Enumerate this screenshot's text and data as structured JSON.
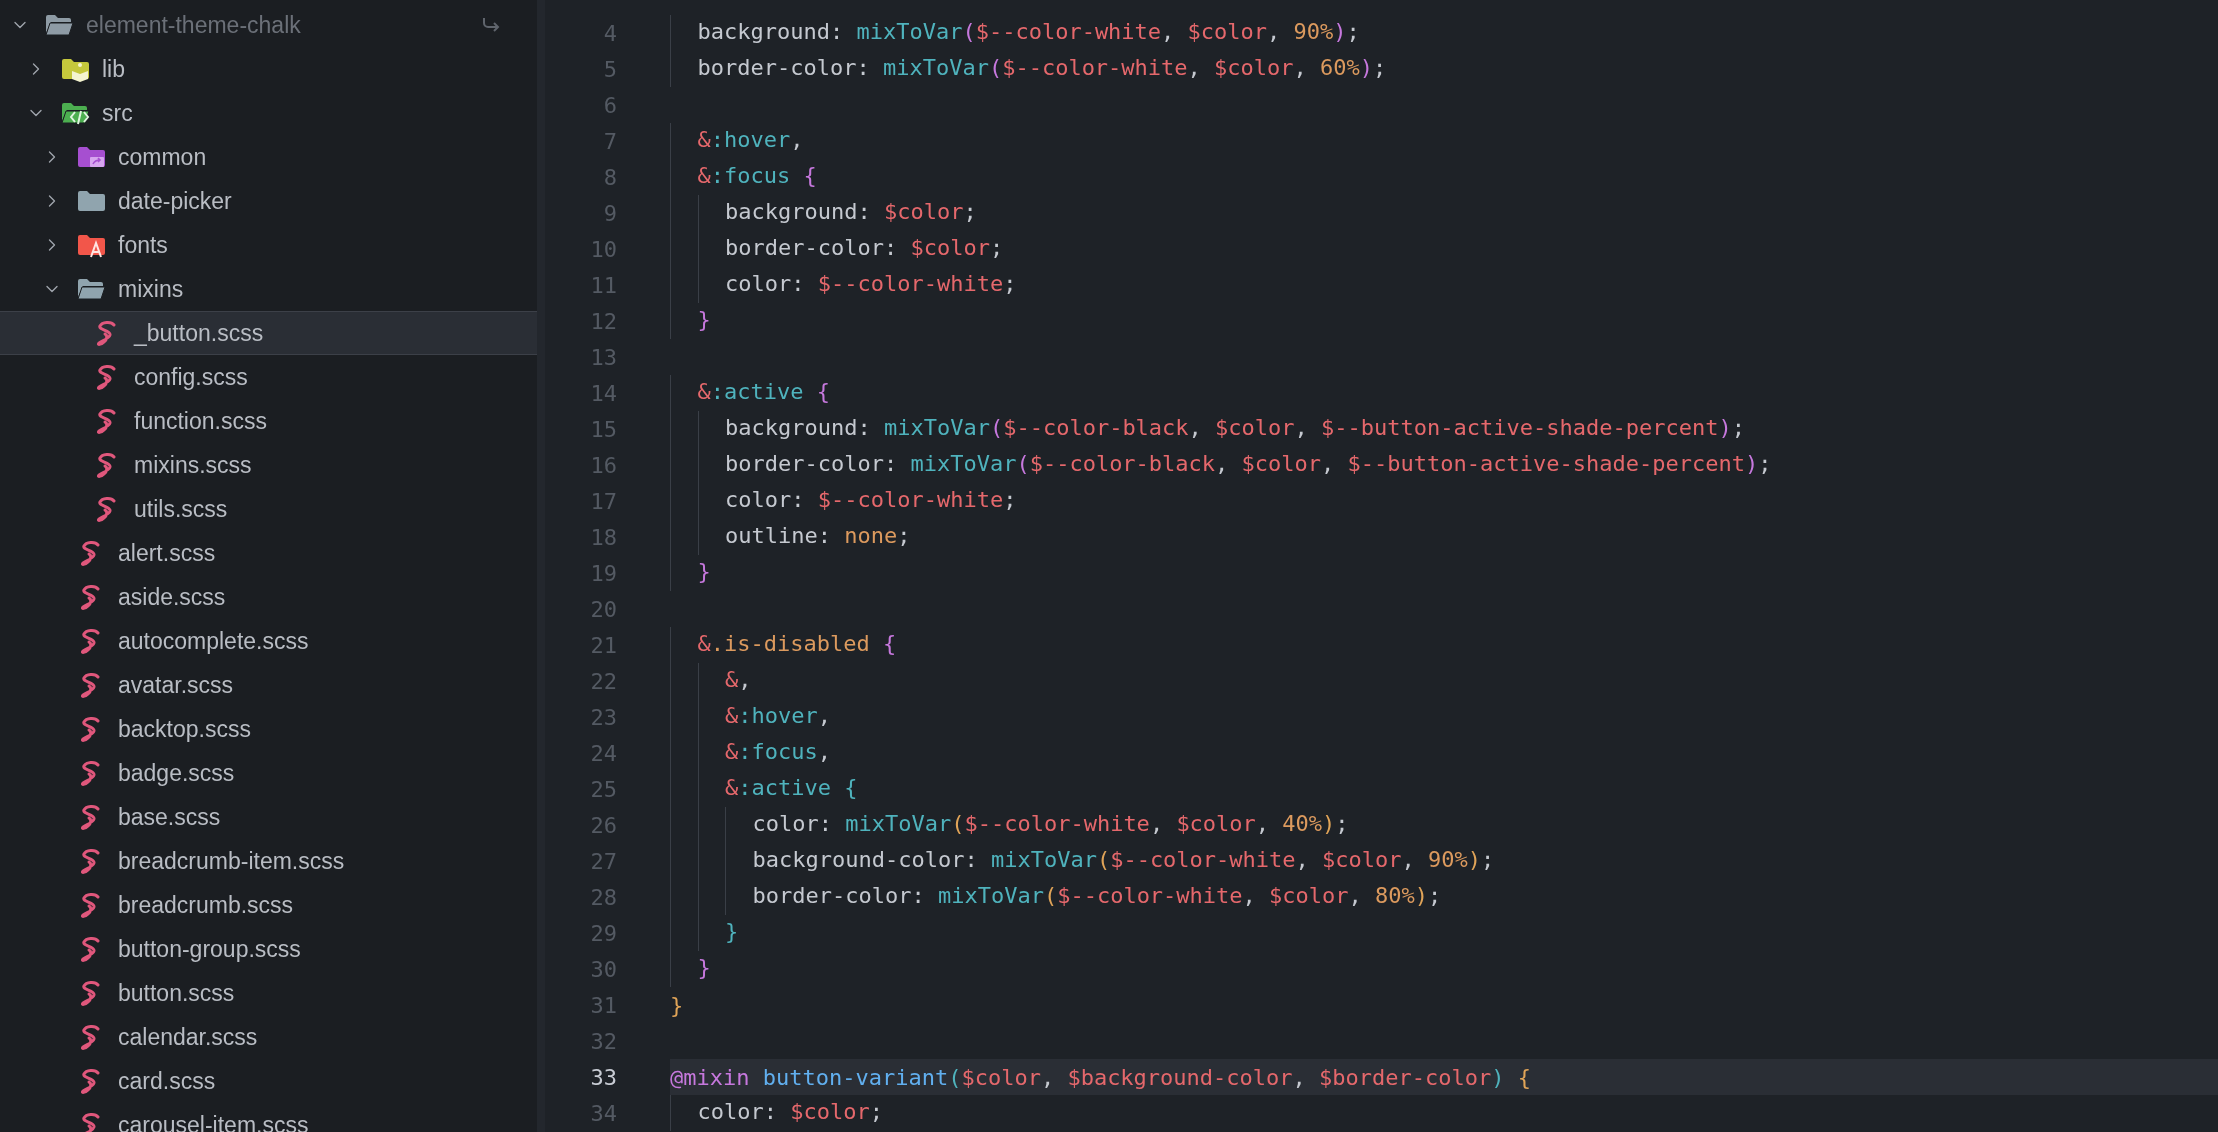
{
  "sidebar": {
    "tree": [
      {
        "label": "element-theme-chalk",
        "kind": "folder",
        "color": "#8e9ba5",
        "expanded": true,
        "selected": false,
        "children": [
          {
            "label": "lib",
            "kind": "library-folder",
            "color": "#c5c83c",
            "expanded": false,
            "selected": false
          },
          {
            "label": "src",
            "kind": "source-folder",
            "color": "#4caf50",
            "expanded": true,
            "selected": false,
            "children": [
              {
                "label": "common",
                "kind": "shared-folder",
                "color": "#a64fd0",
                "expanded": false,
                "selected": false
              },
              {
                "label": "date-picker",
                "kind": "folder",
                "color": "#90a4ae",
                "expanded": false,
                "selected": false
              },
              {
                "label": "fonts",
                "kind": "font-folder",
                "color": "#f2564a",
                "expanded": false,
                "selected": false
              },
              {
                "label": "mixins",
                "kind": "folder",
                "color": "#90a4ae",
                "expanded": true,
                "selected": false,
                "children": [
                  {
                    "label": "_button.scss",
                    "kind": "scss-file",
                    "selected": true
                  },
                  {
                    "label": "config.scss",
                    "kind": "scss-file",
                    "selected": false
                  },
                  {
                    "label": "function.scss",
                    "kind": "scss-file",
                    "selected": false
                  },
                  {
                    "label": "mixins.scss",
                    "kind": "scss-file",
                    "selected": false
                  },
                  {
                    "label": "utils.scss",
                    "kind": "scss-file",
                    "selected": false
                  }
                ]
              },
              {
                "label": "alert.scss",
                "kind": "scss-file",
                "selected": false
              },
              {
                "label": "aside.scss",
                "kind": "scss-file",
                "selected": false
              },
              {
                "label": "autocomplete.scss",
                "kind": "scss-file",
                "selected": false
              },
              {
                "label": "avatar.scss",
                "kind": "scss-file",
                "selected": false
              },
              {
                "label": "backtop.scss",
                "kind": "scss-file",
                "selected": false
              },
              {
                "label": "badge.scss",
                "kind": "scss-file",
                "selected": false
              },
              {
                "label": "base.scss",
                "kind": "scss-file",
                "selected": false
              },
              {
                "label": "breadcrumb-item.scss",
                "kind": "scss-file",
                "selected": false
              },
              {
                "label": "breadcrumb.scss",
                "kind": "scss-file",
                "selected": false
              },
              {
                "label": "button-group.scss",
                "kind": "scss-file",
                "selected": false
              },
              {
                "label": "button.scss",
                "kind": "scss-file",
                "selected": false
              },
              {
                "label": "calendar.scss",
                "kind": "scss-file",
                "selected": false
              },
              {
                "label": "card.scss",
                "kind": "scss-file",
                "selected": false
              },
              {
                "label": "carousel-item.scss",
                "kind": "scss-file",
                "selected": false
              }
            ]
          }
        ]
      }
    ]
  },
  "editor": {
    "lines": [
      {
        "number": "4",
        "current": false,
        "tokens": [
          {
            "text": "  background: ",
            "kind": "prop"
          },
          {
            "text": "mixToVar",
            "kind": "fn"
          },
          {
            "text": "(",
            "kind": "bracket1"
          },
          {
            "text": "$--color-white",
            "kind": "var"
          },
          {
            "text": ", ",
            "kind": "punc"
          },
          {
            "text": "$color",
            "kind": "var"
          },
          {
            "text": ", ",
            "kind": "punc"
          },
          {
            "text": "90%",
            "kind": "num"
          },
          {
            "text": ")",
            "kind": "bracket1"
          },
          {
            "text": ";",
            "kind": "punc"
          }
        ]
      },
      {
        "number": "5",
        "current": false,
        "tokens": [
          {
            "text": "  border-color: ",
            "kind": "prop"
          },
          {
            "text": "mixToVar",
            "kind": "fn"
          },
          {
            "text": "(",
            "kind": "bracket1"
          },
          {
            "text": "$--color-white",
            "kind": "var"
          },
          {
            "text": ", ",
            "kind": "punc"
          },
          {
            "text": "$color",
            "kind": "var"
          },
          {
            "text": ", ",
            "kind": "punc"
          },
          {
            "text": "60%",
            "kind": "num"
          },
          {
            "text": ")",
            "kind": "bracket1"
          },
          {
            "text": ";",
            "kind": "punc"
          }
        ]
      },
      {
        "number": "6",
        "current": false
      },
      {
        "number": "7",
        "current": false,
        "tokens": [
          {
            "text": "  &",
            "kind": "var"
          },
          {
            "text": ":hover",
            "kind": "fn"
          },
          {
            "text": ",",
            "kind": "punc"
          }
        ]
      },
      {
        "number": "8",
        "current": false,
        "tokens": [
          {
            "text": "  &",
            "kind": "var"
          },
          {
            "text": ":focus",
            "kind": "fn"
          },
          {
            "text": " {",
            "kind": "bracket1"
          }
        ]
      },
      {
        "number": "9",
        "current": false,
        "tokens": [
          {
            "text": "    background: ",
            "kind": "prop"
          },
          {
            "text": "$color",
            "kind": "var"
          },
          {
            "text": ";",
            "kind": "punc"
          }
        ]
      },
      {
        "number": "10",
        "current": false,
        "tokens": [
          {
            "text": "    border-color: ",
            "kind": "prop"
          },
          {
            "text": "$color",
            "kind": "var"
          },
          {
            "text": ";",
            "kind": "punc"
          }
        ]
      },
      {
        "number": "11",
        "current": false,
        "tokens": [
          {
            "text": "    color: ",
            "kind": "prop"
          },
          {
            "text": "$--color-white",
            "kind": "var"
          },
          {
            "text": ";",
            "kind": "punc"
          }
        ]
      },
      {
        "number": "12",
        "current": false,
        "tokens": [
          {
            "text": "  }",
            "kind": "bracket1"
          }
        ]
      },
      {
        "number": "13",
        "current": false
      },
      {
        "number": "14",
        "current": false,
        "tokens": [
          {
            "text": "  &",
            "kind": "var"
          },
          {
            "text": ":active",
            "kind": "fn"
          },
          {
            "text": " {",
            "kind": "bracket1"
          }
        ]
      },
      {
        "number": "15",
        "current": false,
        "tokens": [
          {
            "text": "    background: ",
            "kind": "prop"
          },
          {
            "text": "mixToVar",
            "kind": "fn"
          },
          {
            "text": "(",
            "kind": "bracket1"
          },
          {
            "text": "$--color-black",
            "kind": "var"
          },
          {
            "text": ", ",
            "kind": "punc"
          },
          {
            "text": "$color",
            "kind": "var"
          },
          {
            "text": ", ",
            "kind": "punc"
          },
          {
            "text": "$--button-active-shade-percent",
            "kind": "var"
          },
          {
            "text": ")",
            "kind": "bracket1"
          },
          {
            "text": ";",
            "kind": "punc"
          }
        ]
      },
      {
        "number": "16",
        "current": false,
        "tokens": [
          {
            "text": "    border-color: ",
            "kind": "prop"
          },
          {
            "text": "mixToVar",
            "kind": "fn"
          },
          {
            "text": "(",
            "kind": "bracket1"
          },
          {
            "text": "$--color-black",
            "kind": "var"
          },
          {
            "text": ", ",
            "kind": "punc"
          },
          {
            "text": "$color",
            "kind": "var"
          },
          {
            "text": ", ",
            "kind": "punc"
          },
          {
            "text": "$--button-active-shade-percent",
            "kind": "var"
          },
          {
            "text": ")",
            "kind": "bracket1"
          },
          {
            "text": ";",
            "kind": "punc"
          }
        ]
      },
      {
        "number": "17",
        "current": false,
        "tokens": [
          {
            "text": "    color: ",
            "kind": "prop"
          },
          {
            "text": "$--color-white",
            "kind": "var"
          },
          {
            "text": ";",
            "kind": "punc"
          }
        ]
      },
      {
        "number": "18",
        "current": false,
        "tokens": [
          {
            "text": "    outline: ",
            "kind": "prop"
          },
          {
            "text": "none",
            "kind": "num"
          },
          {
            "text": ";",
            "kind": "punc"
          }
        ]
      },
      {
        "number": "19",
        "current": false,
        "tokens": [
          {
            "text": "  }",
            "kind": "bracket1"
          }
        ]
      },
      {
        "number": "20",
        "current": false
      },
      {
        "number": "21",
        "current": false,
        "tokens": [
          {
            "text": "  &",
            "kind": "var"
          },
          {
            "text": ".is-disabled",
            "kind": "num"
          },
          {
            "text": " {",
            "kind": "bracket1"
          }
        ]
      },
      {
        "number": "22",
        "current": false,
        "tokens": [
          {
            "text": "    &",
            "kind": "var"
          },
          {
            "text": ",",
            "kind": "punc"
          }
        ]
      },
      {
        "number": "23",
        "current": false,
        "tokens": [
          {
            "text": "    &",
            "kind": "var"
          },
          {
            "text": ":hover",
            "kind": "fn"
          },
          {
            "text": ",",
            "kind": "punc"
          }
        ]
      },
      {
        "number": "24",
        "current": false,
        "tokens": [
          {
            "text": "    &",
            "kind": "var"
          },
          {
            "text": ":focus",
            "kind": "fn"
          },
          {
            "text": ",",
            "kind": "punc"
          }
        ]
      },
      {
        "number": "25",
        "current": false,
        "tokens": [
          {
            "text": "    &",
            "kind": "var"
          },
          {
            "text": ":active",
            "kind": "fn"
          },
          {
            "text": " {",
            "kind": "bracket3"
          }
        ]
      },
      {
        "number": "26",
        "current": false,
        "tokens": [
          {
            "text": "      color: ",
            "kind": "prop"
          },
          {
            "text": "mixToVar",
            "kind": "fn"
          },
          {
            "text": "(",
            "kind": "bracket2"
          },
          {
            "text": "$--color-white",
            "kind": "var"
          },
          {
            "text": ", ",
            "kind": "punc"
          },
          {
            "text": "$color",
            "kind": "var"
          },
          {
            "text": ", ",
            "kind": "punc"
          },
          {
            "text": "40%",
            "kind": "num"
          },
          {
            "text": ")",
            "kind": "bracket2"
          },
          {
            "text": ";",
            "kind": "punc"
          }
        ]
      },
      {
        "number": "27",
        "current": false,
        "tokens": [
          {
            "text": "      background-color: ",
            "kind": "prop"
          },
          {
            "text": "mixToVar",
            "kind": "fn"
          },
          {
            "text": "(",
            "kind": "bracket2"
          },
          {
            "text": "$--color-white",
            "kind": "var"
          },
          {
            "text": ", ",
            "kind": "punc"
          },
          {
            "text": "$color",
            "kind": "var"
          },
          {
            "text": ", ",
            "kind": "punc"
          },
          {
            "text": "90%",
            "kind": "num"
          },
          {
            "text": ")",
            "kind": "bracket2"
          },
          {
            "text": ";",
            "kind": "punc"
          }
        ]
      },
      {
        "number": "28",
        "current": false,
        "tokens": [
          {
            "text": "      border-color: ",
            "kind": "prop"
          },
          {
            "text": "mixToVar",
            "kind": "fn"
          },
          {
            "text": "(",
            "kind": "bracket2"
          },
          {
            "text": "$--color-white",
            "kind": "var"
          },
          {
            "text": ", ",
            "kind": "punc"
          },
          {
            "text": "$color",
            "kind": "var"
          },
          {
            "text": ", ",
            "kind": "punc"
          },
          {
            "text": "80%",
            "kind": "num"
          },
          {
            "text": ")",
            "kind": "bracket2"
          },
          {
            "text": ";",
            "kind": "punc"
          }
        ]
      },
      {
        "number": "29",
        "current": false,
        "tokens": [
          {
            "text": "    }",
            "kind": "bracket3"
          }
        ]
      },
      {
        "number": "30",
        "current": false,
        "tokens": [
          {
            "text": "  }",
            "kind": "bracket1"
          }
        ]
      },
      {
        "number": "31",
        "current": false,
        "tokens": [
          {
            "text": "}",
            "kind": "bracket2"
          }
        ]
      },
      {
        "number": "32",
        "current": false
      },
      {
        "number": "33",
        "current": true,
        "tokens": [
          {
            "text": "@mixin ",
            "kind": "keyword"
          },
          {
            "text": "button-variant",
            "kind": "name"
          },
          {
            "text": "(",
            "kind": "bracket3"
          },
          {
            "text": "$color",
            "kind": "var"
          },
          {
            "text": ", ",
            "kind": "punc"
          },
          {
            "text": "$background-color",
            "kind": "var"
          },
          {
            "text": ", ",
            "kind": "punc"
          },
          {
            "text": "$border-color",
            "kind": "var"
          },
          {
            "text": ")",
            "kind": "bracket3"
          },
          {
            "text": " {",
            "kind": "bracket2"
          }
        ]
      },
      {
        "number": "34",
        "current": false,
        "tokens": [
          {
            "text": "  color: ",
            "kind": "prop"
          },
          {
            "text": "$color",
            "kind": "var"
          },
          {
            "text": ";",
            "kind": "punc"
          }
        ]
      }
    ]
  }
}
